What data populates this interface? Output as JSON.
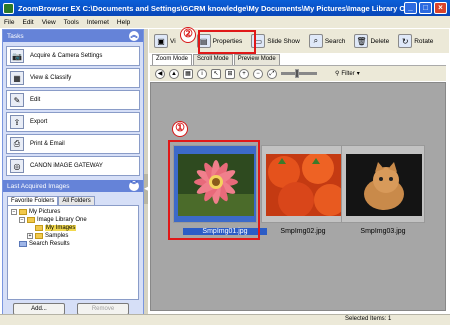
{
  "window": {
    "title": "ZoomBrowser EX    C:\\Documents and Settings\\GCRM knowledge\\My Documents\\My Pictures\\Image Library On...",
    "controls": [
      "minimize",
      "maximize",
      "close"
    ]
  },
  "menu": [
    "File",
    "Edit",
    "View",
    "Tools",
    "Internet",
    "Help"
  ],
  "tasks": {
    "header": "Tasks",
    "items": [
      {
        "label": "Acquire & Camera Settings",
        "icon": "camera-icon"
      },
      {
        "label": "View & Classify",
        "icon": "view-icon"
      },
      {
        "label": "Edit",
        "icon": "edit-icon"
      },
      {
        "label": "Export",
        "icon": "export-icon"
      },
      {
        "label": "Print & Email",
        "icon": "printer-icon"
      },
      {
        "label": "CANON iMAGE GATEWAY",
        "icon": "gateway-icon"
      }
    ]
  },
  "last_acquired": {
    "header": "Last Acquired Images",
    "tabs": [
      "Favorite Folders",
      "All Folders"
    ],
    "tree": [
      {
        "label": "My Pictures",
        "level": 0
      },
      {
        "label": "Image Library One",
        "level": 1
      },
      {
        "label": "My Images",
        "level": 2,
        "selected": true
      },
      {
        "label": "Samples",
        "level": 2
      },
      {
        "label": "Search Results",
        "level": 0
      }
    ],
    "add_label": "Add...",
    "remove_label": "Remove"
  },
  "toolbar": {
    "buttons": [
      {
        "label": "Vi",
        "icon": "view-mode-icon"
      },
      {
        "label": "Properties",
        "icon": "properties-icon"
      },
      {
        "label": "Slide Show",
        "icon": "slideshow-icon"
      },
      {
        "label": "Search",
        "icon": "search-icon"
      },
      {
        "label": "Delete",
        "icon": "trash-icon"
      },
      {
        "label": "Rotate",
        "icon": "rotate-icon"
      }
    ]
  },
  "mode_tabs": [
    "Zoom Mode",
    "Scroll Mode",
    "Preview Mode"
  ],
  "filter_label": "Filter",
  "images": [
    {
      "name": "SmpImg01.jpg",
      "selected": true
    },
    {
      "name": "SmpImg02.jpg",
      "selected": false
    },
    {
      "name": "SmpImg03.jpg",
      "selected": false
    }
  ],
  "callouts": [
    "①",
    "②"
  ],
  "status": "Selected Items: 1",
  "colors": {
    "titlebar": "#0a5fd8",
    "highlight": "#e01818",
    "selection": "#2b5cc6"
  }
}
